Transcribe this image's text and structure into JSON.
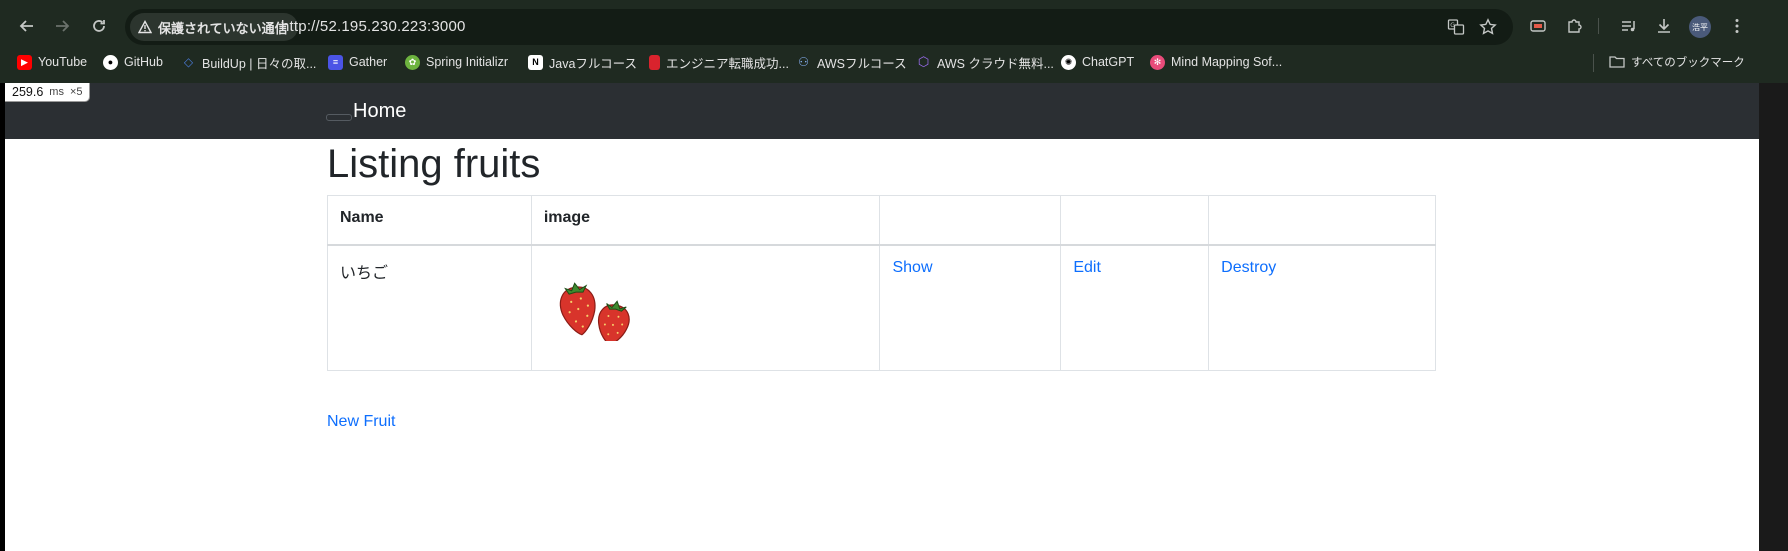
{
  "browser": {
    "security_label": "保護されていない通信",
    "url": "http://52.195.230.223:3000",
    "profile_initials": "浩平",
    "bookmarks": [
      {
        "label": "YouTube",
        "icon": "youtube-icon",
        "color": "#ff0000"
      },
      {
        "label": "GitHub",
        "icon": "github-icon",
        "color": "#ffffff"
      },
      {
        "label": "BuildUp | 日々の取...",
        "icon": "buildup-icon",
        "color": "#4a7bd8"
      },
      {
        "label": "Gather",
        "icon": "gather-icon",
        "color": "#4b54e6"
      },
      {
        "label": "Spring Initializr",
        "icon": "spring-icon",
        "color": "#6db33f"
      },
      {
        "label": "Javaフルコース",
        "icon": "notion-icon",
        "color": "#ffffff"
      },
      {
        "label": "エンジニア転職成功...",
        "icon": "bookmark-red-icon",
        "color": "#d9232d"
      },
      {
        "label": "AWSフルコース",
        "icon": "aws-people-icon",
        "color": "#8ab4f8"
      },
      {
        "label": "AWS クラウド無料...",
        "icon": "aws-cube-icon",
        "color": "#9b6cf0"
      },
      {
        "label": "ChatGPT",
        "icon": "chatgpt-icon",
        "color": "#ffffff"
      },
      {
        "label": "Mind Mapping Sof...",
        "icon": "mindmap-icon",
        "color": "#e94b7a"
      }
    ],
    "all_bookmarks_label": "すべてのブックマーク"
  },
  "perf_overlay": {
    "value": "259.6",
    "unit": "ms",
    "multiplier": "×5"
  },
  "navbar": {
    "brand": "Home"
  },
  "page": {
    "title": "Listing fruits",
    "table": {
      "headers": [
        "Name",
        "image",
        "",
        "",
        ""
      ],
      "rows": [
        {
          "name": "いちご",
          "image": "strawberry-image",
          "show": "Show",
          "edit": "Edit",
          "destroy": "Destroy"
        }
      ]
    },
    "new_link": "New Fruit"
  },
  "colors": {
    "chrome_bg": "#1f2a21",
    "navbar_bg": "#2b2f33",
    "link": "#0d6efd"
  }
}
